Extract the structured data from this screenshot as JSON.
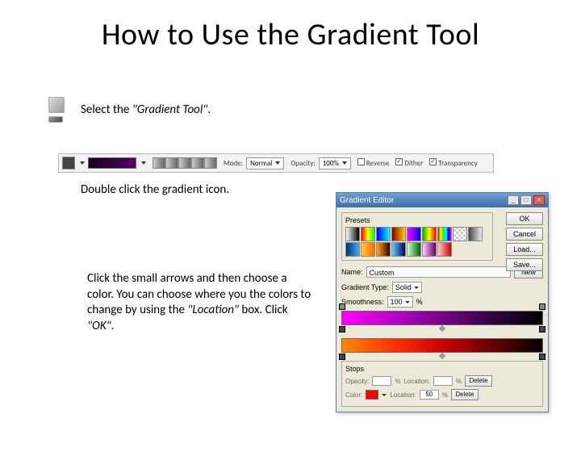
{
  "title": "How to Use the Gradient Tool",
  "step1": {
    "prefix": "Select the ",
    "tool": "\"Gradient Tool\"",
    "suffix": "."
  },
  "optbar": {
    "mode_lbl": "Mode:",
    "mode_val": "Normal",
    "opac_lbl": "Opacity:",
    "opac_val": "100%",
    "reverse": "Reverse",
    "dither": "Dither",
    "trans": "Transparency"
  },
  "step2": "Double click the gradient icon.",
  "step3": {
    "t1": "Click the small arrows and then choose a color. You can choose where you the colors to change by using the ",
    "loc": "\"Location\"",
    "t2": " box. Click ",
    "ok": "\"OK\"",
    "t3": "."
  },
  "dlg": {
    "title": "Gradient Editor",
    "presets_lbl": "Presets",
    "ok": "OK",
    "cancel": "Cancel",
    "load": "Load...",
    "save": "Save...",
    "name_lbl": "Name:",
    "name_val": "Custom",
    "new": "New",
    "type_lbl": "Gradient Type:",
    "type_val": "Solid",
    "smooth_lbl": "Smoothness:",
    "smooth_val": "100",
    "pct": "%",
    "stops_lbl": "Stops",
    "opacity_lbl": "Opacity:",
    "loc_lbl": "Location:",
    "loc_val": "50",
    "delete": "Delete",
    "color_lbl": "Color:"
  }
}
